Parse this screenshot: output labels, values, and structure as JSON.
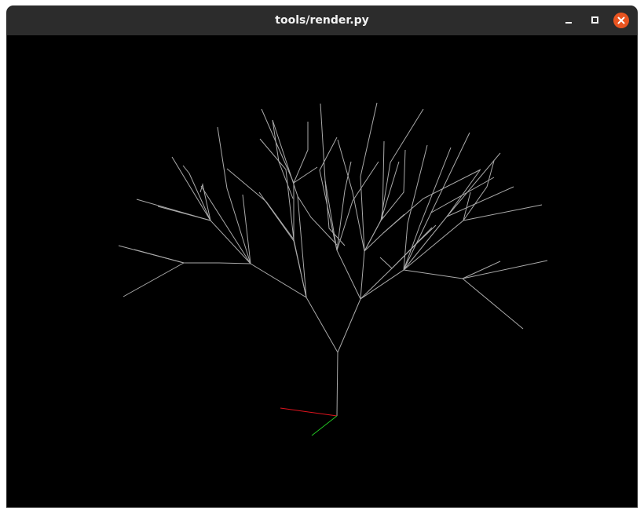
{
  "window": {
    "title": "tools/render.py"
  },
  "controls": {
    "minimize_icon": "minimize-icon",
    "maximize_icon": "maximize-icon",
    "close_icon": "close-icon"
  },
  "viewport": {
    "background": "#000000",
    "branch_color": "#bdbdbd",
    "axis_x_color": "#e0141e",
    "axis_y_color": "#23c523"
  }
}
